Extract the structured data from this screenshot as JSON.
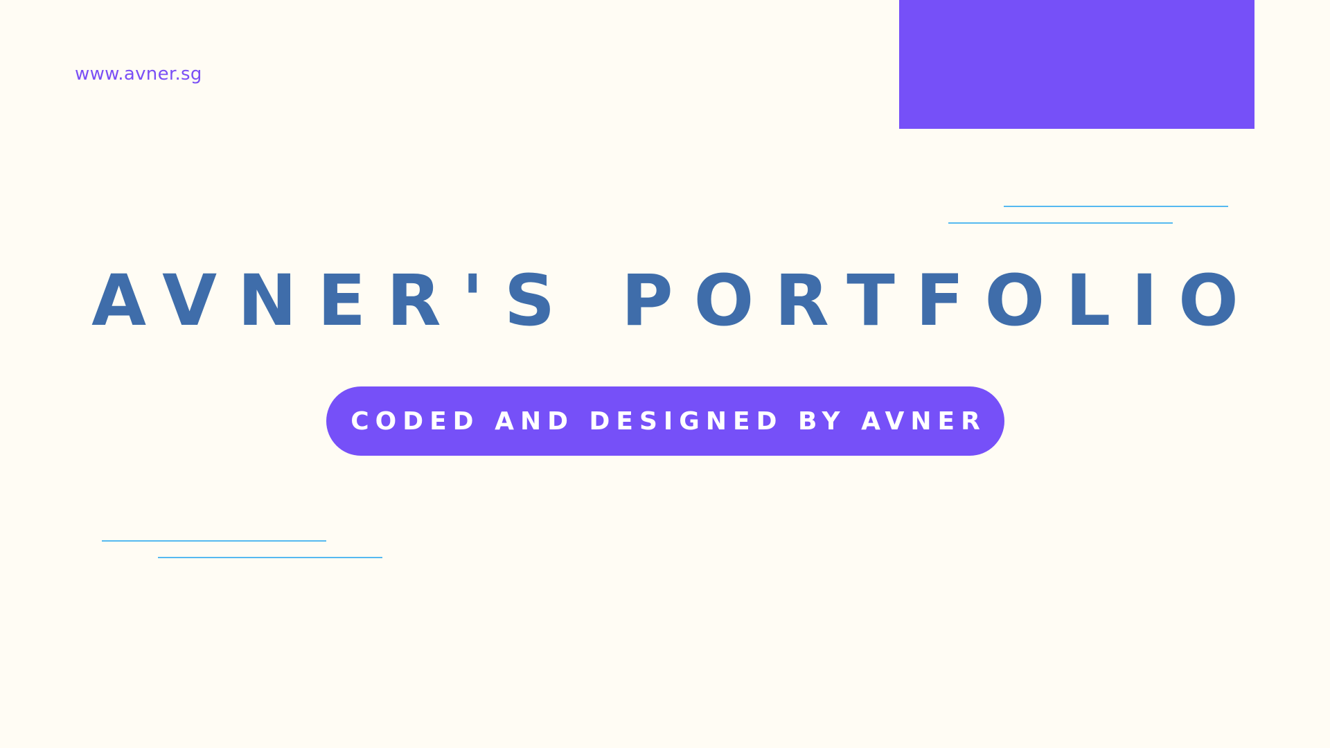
{
  "header": {
    "site_url": "www.avner.sg"
  },
  "hero": {
    "title": "AVNER'S PORTFOLIO",
    "subtitle": "CODED AND DESIGNED BY AVNER"
  },
  "colors": {
    "background": "#FFFCF4",
    "accent_purple": "#7650F8",
    "title_blue": "#3F6DAA",
    "line_blue": "#55B9F0",
    "url_purple": "#7A4FF5"
  }
}
